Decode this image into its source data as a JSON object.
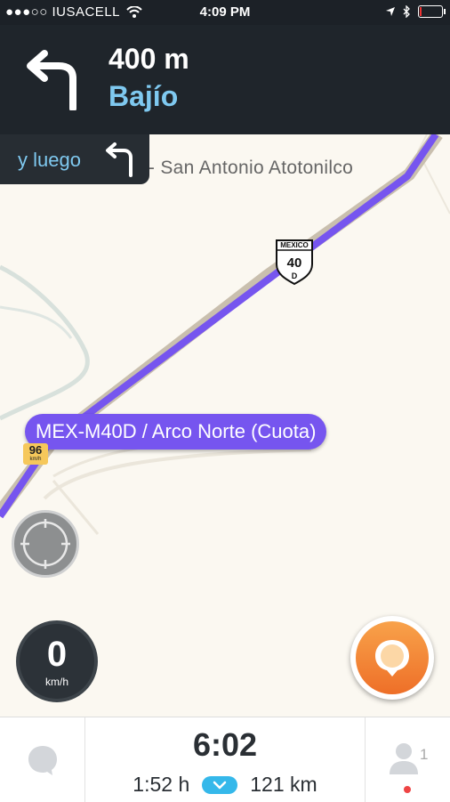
{
  "status_bar": {
    "carrier": "●●●○○ IUSACELL",
    "time": "4:09 PM",
    "icons": [
      "wifi-icon",
      "location-arrow-icon",
      "bluetooth-icon",
      "battery-icon"
    ]
  },
  "navigation": {
    "distance": "400 m",
    "street": "Bajío",
    "turn_icon": "turn-left-icon",
    "then_label": "y luego",
    "then_icon": "turn-left-icon"
  },
  "map": {
    "road_label": "s - San Antonio Atotonilco",
    "highway_shield": {
      "top": "MEXICO",
      "number": "40",
      "suffix": "D"
    },
    "route_banner": "MEX-M40D / Arco Norte (Cuota)",
    "speed_limit": {
      "value": "96",
      "unit": "km/h"
    },
    "route_color": "#7655ef"
  },
  "speedometer": {
    "value": "0",
    "unit": "km/h"
  },
  "trip": {
    "eta": "6:02",
    "duration": "1:52 h",
    "distance": "121 km"
  },
  "friends": {
    "count": "1"
  },
  "colors": {
    "header_bg": "#1f252b",
    "accent_blue": "#7fc9f0",
    "report_orange": "#f28b36"
  }
}
